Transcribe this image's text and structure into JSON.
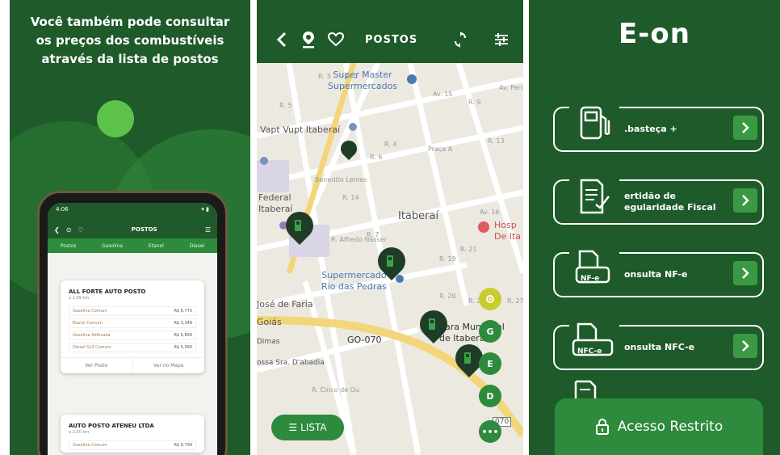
{
  "panel1": {
    "headline": [
      "Você também pode consultar",
      "os preços dos combustíveis",
      "através da lista de postos"
    ],
    "phone": {
      "status_time": "4:06",
      "title": "POSTOS",
      "tabs": [
        "Postos",
        "Gasolina",
        "Etanol",
        "Diesel"
      ],
      "stations": [
        {
          "name": "ALL FORTE AUTO POSTO",
          "distance": "a 2,99 km",
          "fuels": [
            {
              "label": "Gasolina Comum",
              "price": "R$ 6,770"
            },
            {
              "label": "Etanol Comum",
              "price": "R$ 3,349"
            },
            {
              "label": "Gasolina Aditivada",
              "price": "R$ 6,899"
            },
            {
              "label": "Diesel S10 Comum",
              "price": "R$ 5,990"
            }
          ],
          "btn_view": "Ver Posto",
          "btn_map": "Ver no Mapa"
        },
        {
          "name": "AUTO POSTO ATENEU LTDA",
          "distance": "a 3,00 km",
          "fuels": [
            {
              "label": "Gasolina Comum",
              "price": "R$ 6,799"
            }
          ]
        }
      ]
    }
  },
  "panel2": {
    "title": "POSTOS",
    "map_labels": {
      "super_master": "Super Master\nSupermercados",
      "vapt_vupt": "Vapt Vupt Itaberaí",
      "federal": "Federal\nItaberaí",
      "itaberai": "Itaberaí",
      "hospital": "Hosp\nDe Ita",
      "rio_das_pedras": "Supermercado\nRio das Pedras",
      "jose_de_faria": "José de Faria",
      "goias": "Goiás",
      "go070": "GO-070",
      "camara": "hara Municipal\nde Itaberaí",
      "dimas": "Dimas",
      "abadia": "ossa Sra. D'abadia",
      "route_shield": "070"
    },
    "road_labels": [
      "R. 3",
      "R. 2",
      "R. 4",
      "R. 6",
      "R. 5",
      "R. 7",
      "R. 14",
      "R. 19",
      "R. 21",
      "R. 20",
      "R. 25",
      "R. 27",
      "Av. 15",
      "Av. 16",
      "R. 9",
      "R. 13",
      "Praça A",
      "Av. Perimetral",
      "R. Alfredo Nasser",
      "Benedito Lemes",
      "R. Cinco de Ou"
    ],
    "fabs": [
      "G",
      "E",
      "D"
    ],
    "lista_label": "LISTA"
  },
  "panel3": {
    "logo": "E-on",
    "menu": [
      {
        "label": "Abasteça +",
        "shown": ".basteça +",
        "icon": "fuel-pump-icon"
      },
      {
        "label_lines": [
          "ertidão de",
          "egularidade Fiscal"
        ],
        "icon": "certificate-icon"
      },
      {
        "label": "onsulta NF-e",
        "badge": "NF-e",
        "icon": "nfe-document-icon"
      },
      {
        "label": "onsulta NFC-e",
        "badge": "NFC-e",
        "icon": "nfce-document-icon"
      }
    ],
    "acesso": "Acesso Restrito"
  },
  "colors": {
    "brand_dark": "#1f5a2a",
    "brand": "#2e8a3c",
    "pin": "#1f3d26",
    "locate": "#c9cc2e"
  }
}
